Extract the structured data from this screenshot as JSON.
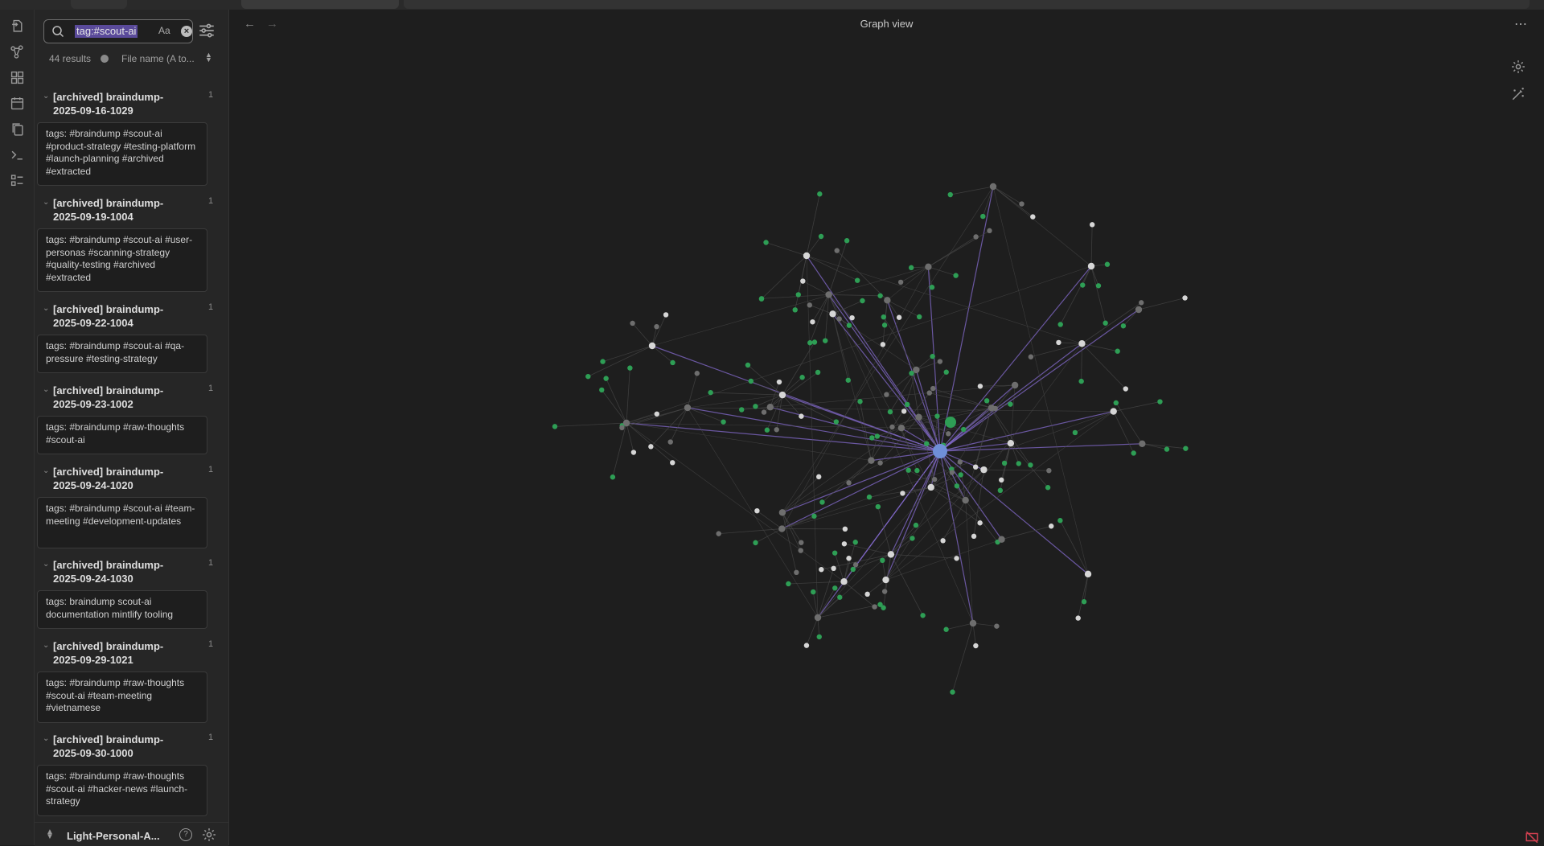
{
  "ribbon": {
    "items": [
      "open-file-icon",
      "graph-icon",
      "canvas-icon",
      "calendar-icon",
      "copy-icon",
      "terminal-icon",
      "checklist-icon"
    ]
  },
  "search": {
    "query": "tag:#scout-ai",
    "match_case_label": "Aa",
    "result_count": "44 results",
    "sort_label": "File name (A to..."
  },
  "results": [
    {
      "title": "[archived] braindump-2025-09-16-1029",
      "count": "1",
      "snippet": "tags: #braindump #scout-ai #product-strategy #testing-platform #launch-planning #archived #extracted"
    },
    {
      "title": "[archived] braindump-2025-09-19-1004",
      "count": "1",
      "snippet": "tags: #braindump #scout-ai #user-personas #scanning-strategy #quality-testing #archived #extracted"
    },
    {
      "title": "[archived] braindump-2025-09-22-1004",
      "count": "1",
      "snippet": "tags: #braindump #scout-ai #qa-pressure #testing-strategy"
    },
    {
      "title": "[archived] braindump-2025-09-23-1002",
      "count": "1",
      "snippet": "tags: #braindump #raw-thoughts #scout-ai"
    },
    {
      "title": "[archived] braindump-2025-09-24-1020",
      "count": "1",
      "snippet": "tags: #braindump #scout-ai #team-meeting #development-updates"
    },
    {
      "title": "[archived] braindump-2025-09-24-1030",
      "count": "1",
      "snippet": "tags: braindump scout-ai documentation mintlify tooling"
    },
    {
      "title": "[archived] braindump-2025-09-29-1021",
      "count": "1",
      "snippet": "tags: #braindump #raw-thoughts #scout-ai #team-meeting #vietnamese"
    },
    {
      "title": "[archived] braindump-2025-09-30-1000",
      "count": "1",
      "snippet": "tags: #braindump #raw-thoughts #scout-ai #hacker-news #launch-strategy"
    }
  ],
  "vault": {
    "name": "Light-Personal-A..."
  },
  "graph": {
    "title": "Graph view",
    "colors": {
      "tag_node": "#2e9e55",
      "note_node": "#d6d6d6",
      "orphan_node": "#6e6e6e",
      "focus_node": "#6f8fd8",
      "focus_edge": "#8a6fd8",
      "edge": "#4a4a4a"
    }
  }
}
